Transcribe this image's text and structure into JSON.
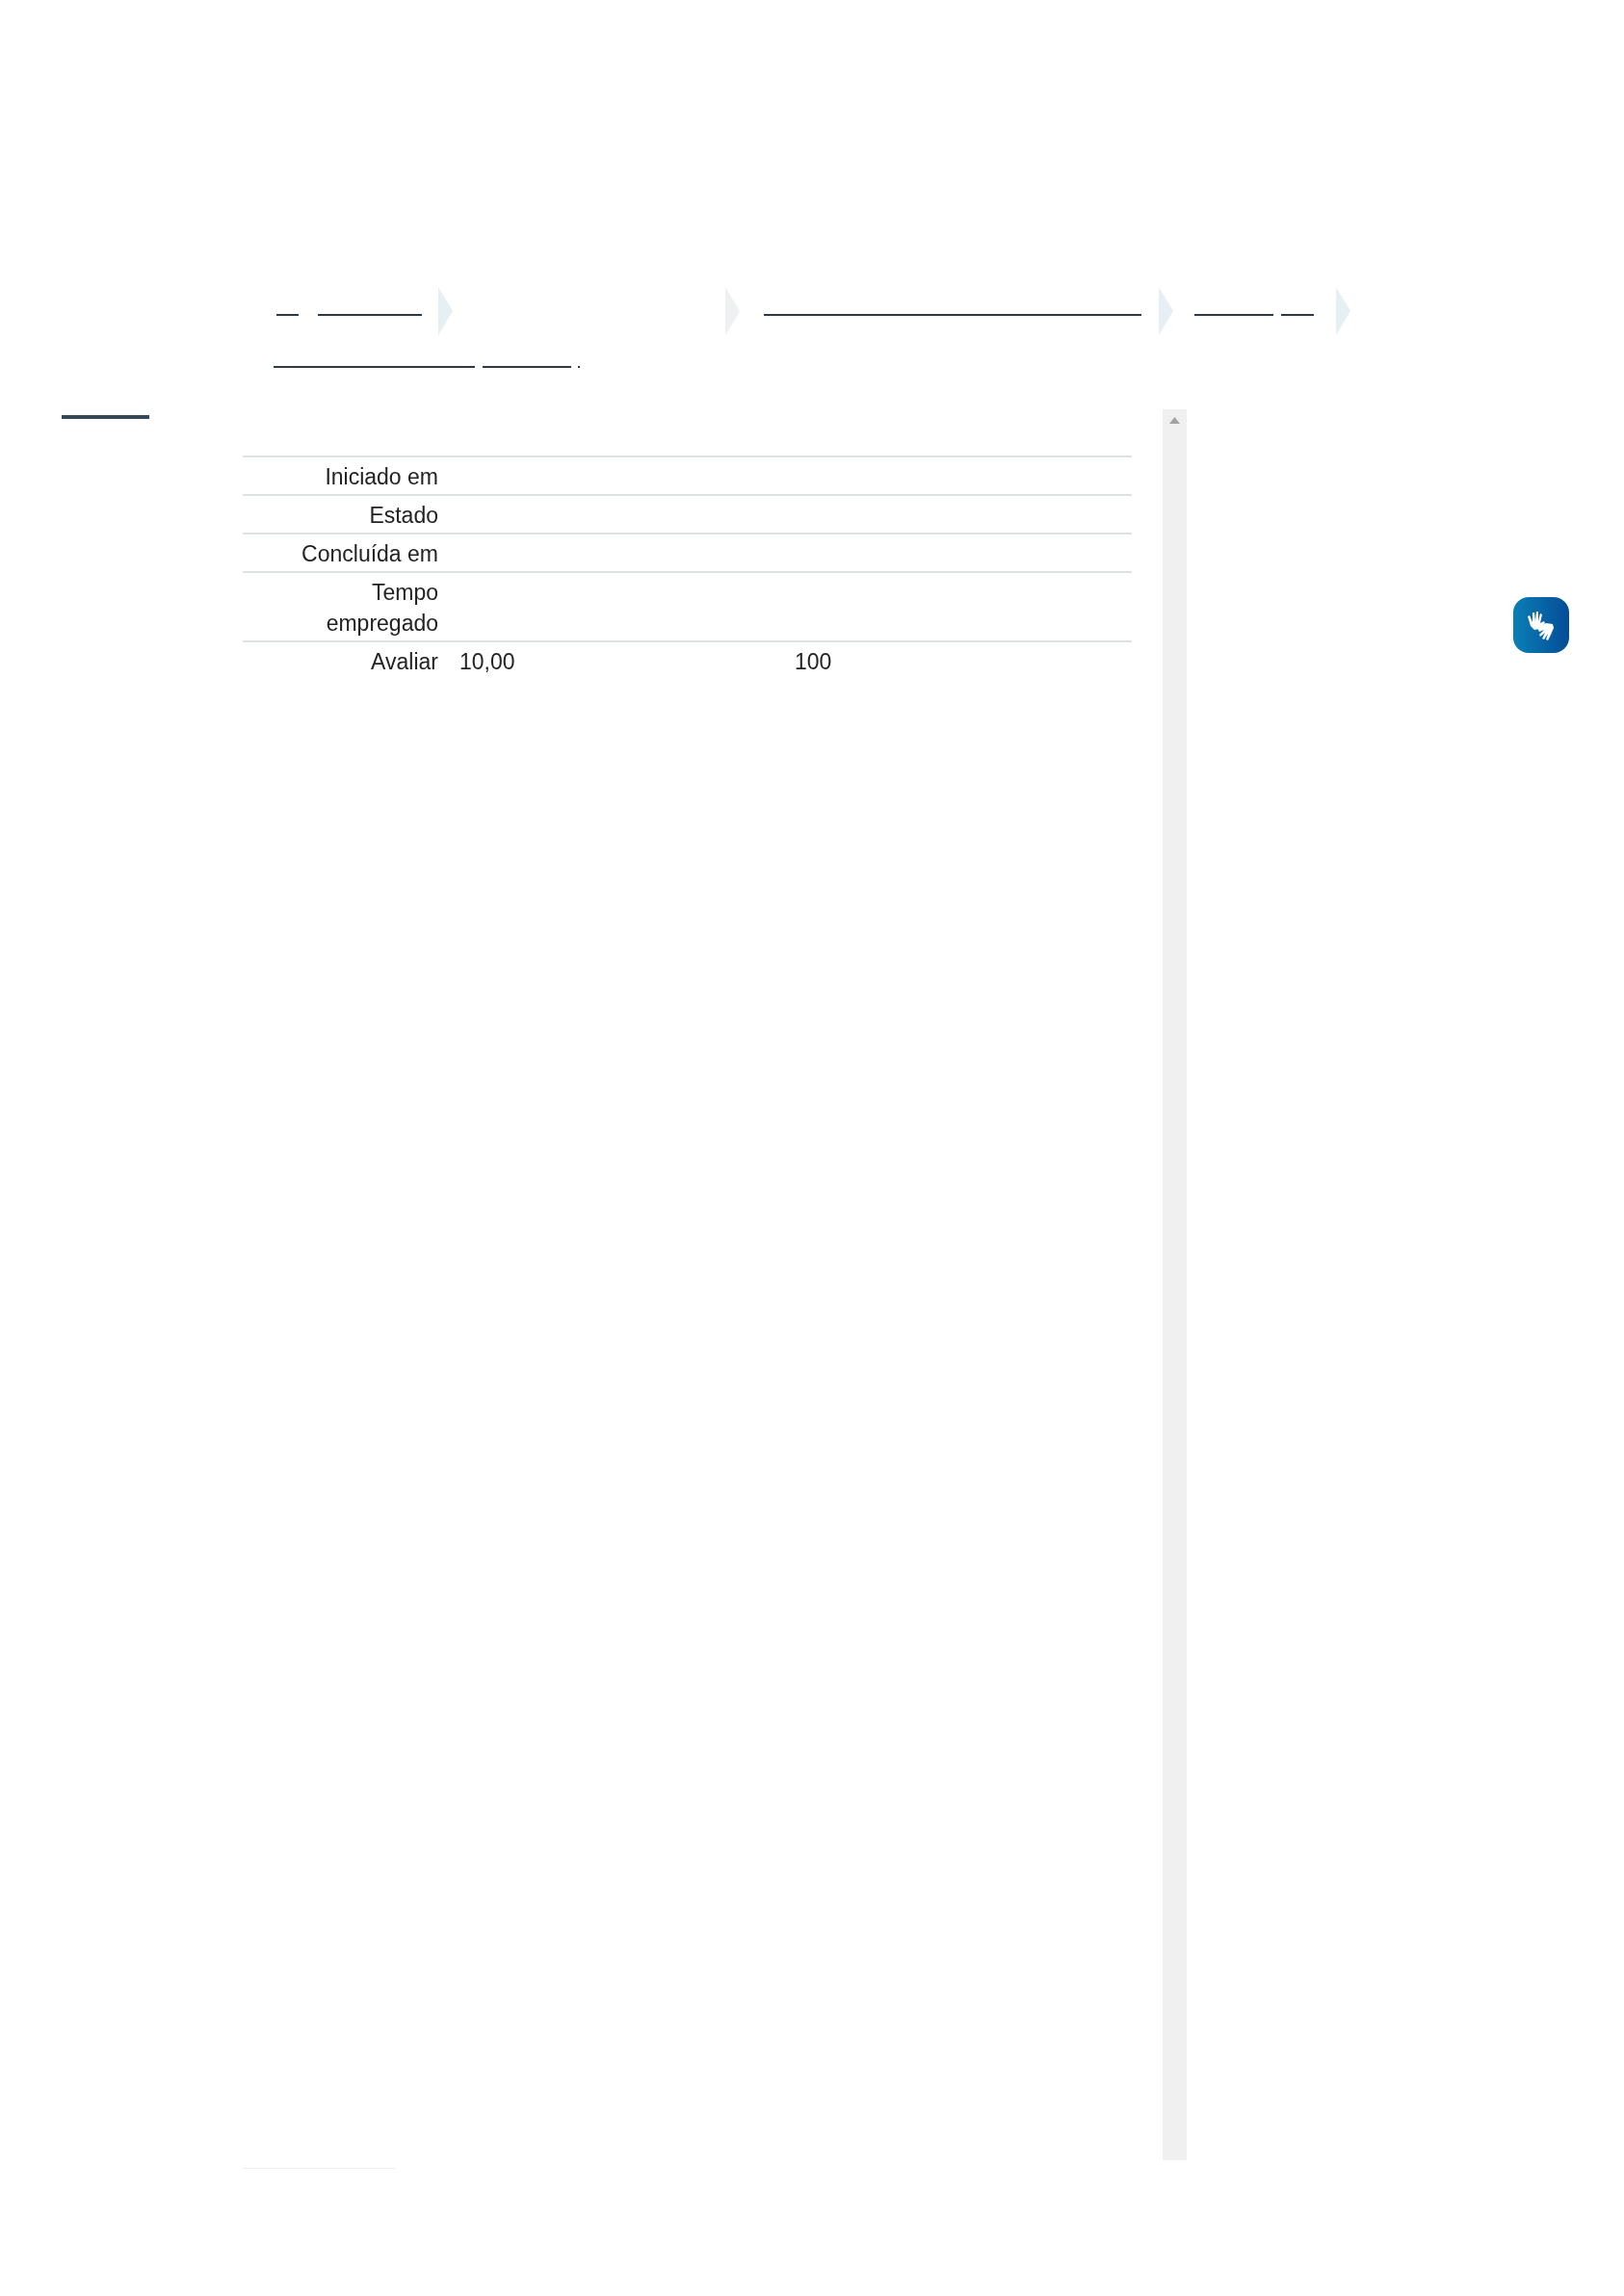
{
  "summary": {
    "rows": [
      {
        "label": "Iniciado em"
      },
      {
        "label": "Estado"
      },
      {
        "label": "Concluída em"
      },
      {
        "label": "Tempo empregado"
      },
      {
        "label": "Avaliar",
        "values": [
          "10,00",
          "100"
        ]
      }
    ]
  }
}
